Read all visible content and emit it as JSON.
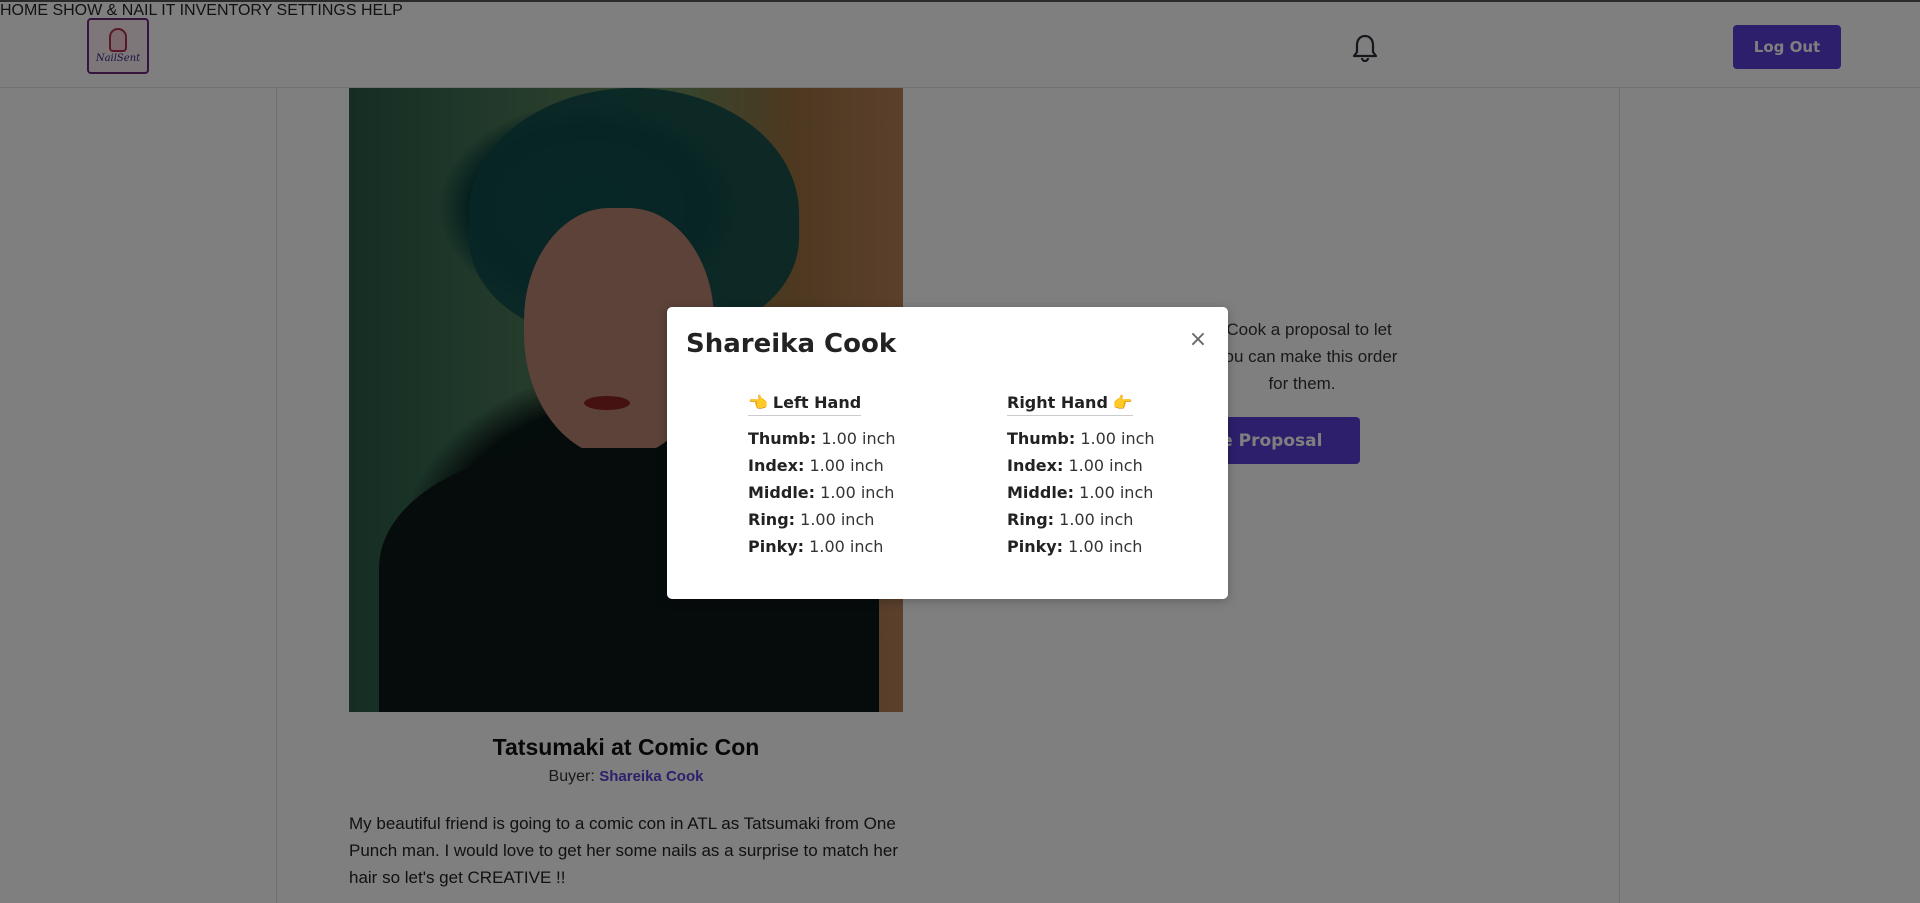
{
  "header": {
    "logo_text": "NailSent",
    "nav": [
      {
        "label": "HOME"
      },
      {
        "label": "SHOW & NAIL IT"
      },
      {
        "label": "INVENTORY"
      },
      {
        "label": "SETTINGS"
      },
      {
        "label": "HELP"
      }
    ],
    "logout_label": "Log Out"
  },
  "post": {
    "title": "Tatsumaki at Comic Con",
    "buyer_label": "Buyer:",
    "buyer_name": "Shareika Cook",
    "description": "My beautiful friend is going to a comic con in ATL as Tatsumaki from One Punch man. I would love to get her some nails as a surprise to match her hair so let's get CREATIVE !!",
    "proposal_text_lines": [
      "a Cook a proposal to let",
      "t you can make this order",
      "for them."
    ],
    "create_proposal_label": "ate Proposal"
  },
  "modal": {
    "title": "Shareika Cook",
    "close_symbol": "×",
    "left_hand": {
      "heading": "Left Hand",
      "icon": "👈",
      "fingers": [
        {
          "name": "Thumb:",
          "value": "1.00 inch"
        },
        {
          "name": "Index:",
          "value": "1.00 inch"
        },
        {
          "name": "Middle:",
          "value": "1.00 inch"
        },
        {
          "name": "Ring:",
          "value": "1.00 inch"
        },
        {
          "name": "Pinky:",
          "value": "1.00 inch"
        }
      ]
    },
    "right_hand": {
      "heading": "Right Hand",
      "icon": "👉",
      "fingers": [
        {
          "name": "Thumb:",
          "value": "1.00 inch"
        },
        {
          "name": "Index:",
          "value": "1.00 inch"
        },
        {
          "name": "Middle:",
          "value": "1.00 inch"
        },
        {
          "name": "Ring:",
          "value": "1.00 inch"
        },
        {
          "name": "Pinky:",
          "value": "1.00 inch"
        }
      ]
    }
  },
  "colors": {
    "accent": "#5a3fd6",
    "overlay": "rgba(0,0,0,0.5)"
  }
}
